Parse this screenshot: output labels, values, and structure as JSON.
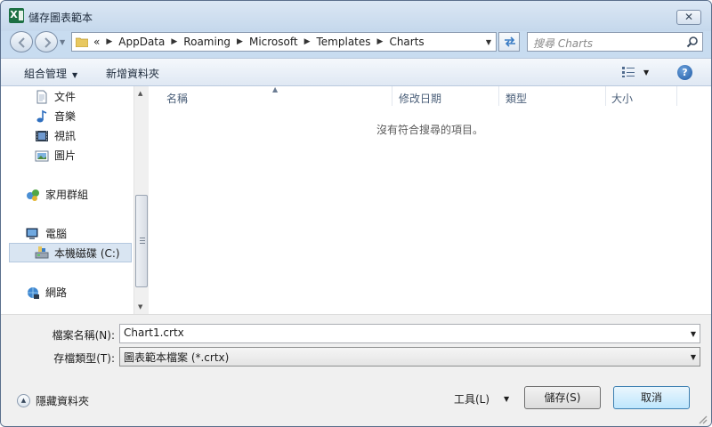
{
  "window": {
    "title": "儲存圖表範本",
    "close_label": "✕"
  },
  "address": {
    "overflow": "«",
    "crumbs": [
      "AppData",
      "Roaming",
      "Microsoft",
      "Templates",
      "Charts"
    ]
  },
  "search": {
    "placeholder": "搜尋 Charts"
  },
  "toolbar": {
    "organize_label": "組合管理",
    "new_folder_label": "新增資料夾",
    "help_label": "?"
  },
  "sidebar": {
    "items": [
      {
        "label": "文件",
        "icon": "documents-icon"
      },
      {
        "label": "音樂",
        "icon": "music-icon"
      },
      {
        "label": "視訊",
        "icon": "video-icon"
      },
      {
        "label": "圖片",
        "icon": "pictures-icon"
      },
      {
        "label": "家用群組",
        "icon": "homegroup-icon"
      },
      {
        "label": "電腦",
        "icon": "computer-icon"
      },
      {
        "label": "本機磁碟 (C:)",
        "icon": "local-disk-icon",
        "selected": true
      },
      {
        "label": "網路",
        "icon": "network-icon"
      }
    ]
  },
  "filelist": {
    "columns": [
      "名稱",
      "修改日期",
      "類型",
      "大小"
    ],
    "empty_message": "沒有符合搜尋的項目。"
  },
  "save_form": {
    "filename_label": "檔案名稱(N):",
    "filename_value": "Chart1.crtx",
    "filetype_label": "存檔類型(T):",
    "filetype_value": "圖表範本檔案 (*.crtx)"
  },
  "footer": {
    "hide_folders_label": "隱藏資料夾",
    "tools_label": "工具(L)",
    "save_label": "儲存(S)",
    "cancel_label": "取消"
  },
  "colors": {
    "accent": "#3c7fb1",
    "frame": "#c8dcf0",
    "selection": "#d9e5f2"
  }
}
